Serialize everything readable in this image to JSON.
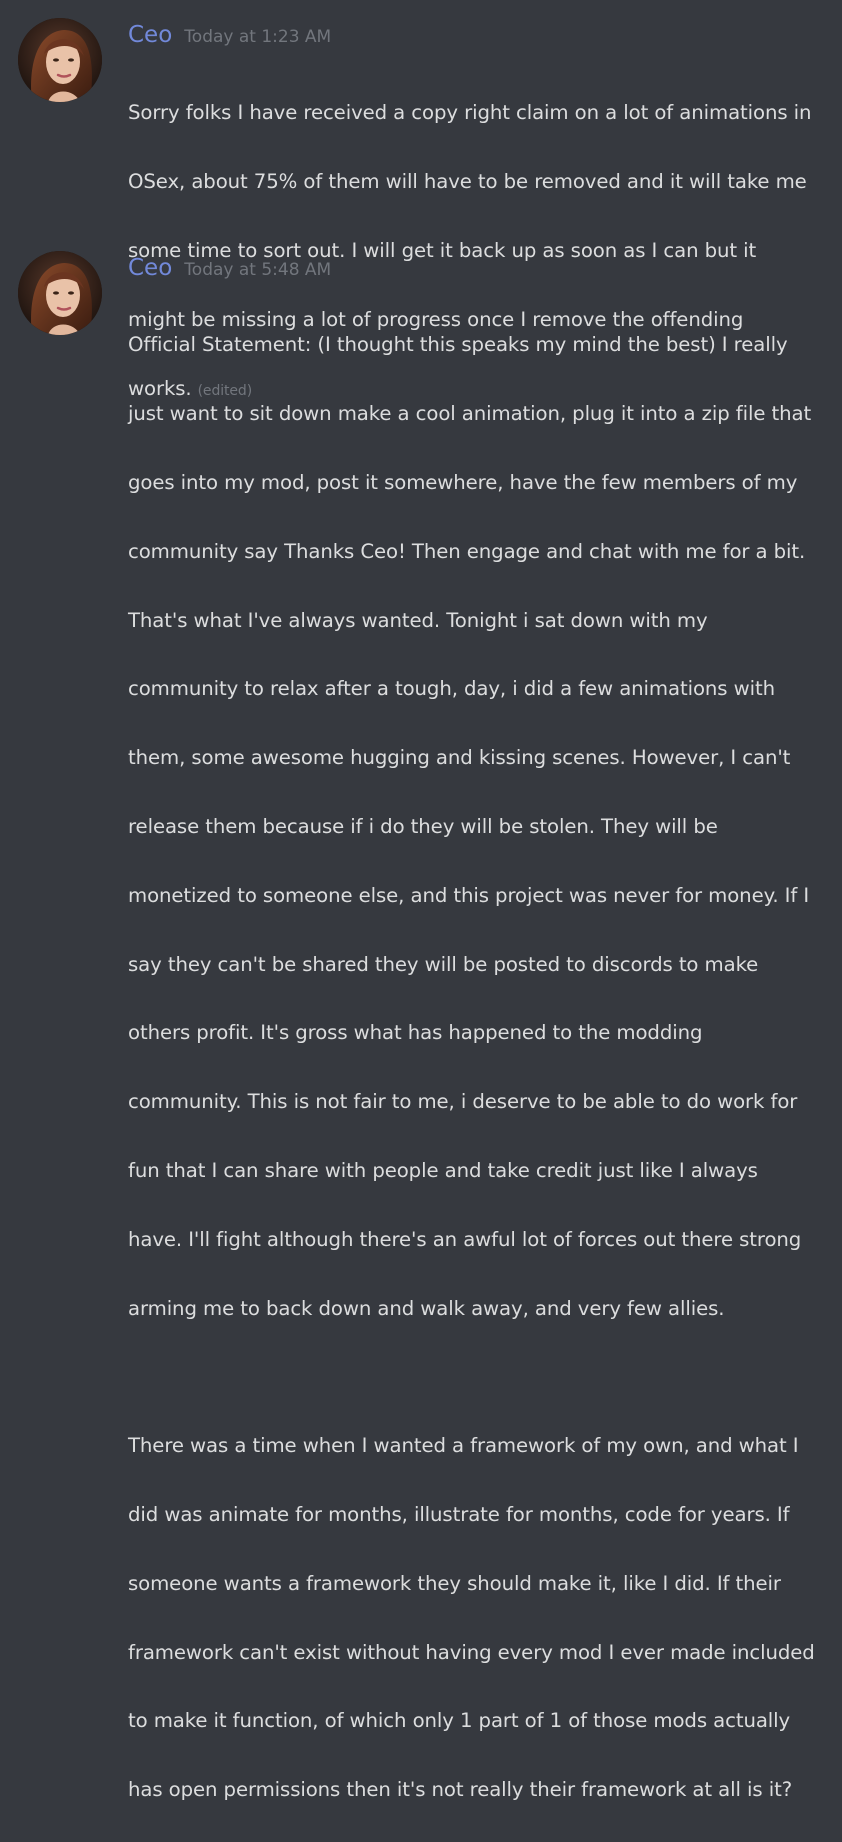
{
  "colors": {
    "background": "#36393f",
    "username": "#7289da",
    "timestamp": "#72767d",
    "text": "#dcddde"
  },
  "messages": [
    {
      "author": "Ceo",
      "timestamp": "Today at 1:23 AM",
      "avatar_icon": "user-avatar",
      "lines": [
        "Sorry folks I have received a copy right claim on a lot of animations in",
        "OSex, about 75% of them will have to be removed and it will take me",
        "some time to sort out. I will get it back up as soon as I can but it",
        "might be missing a lot of progress once I remove the offending",
        "works."
      ],
      "edited_label": "(edited)"
    },
    {
      "author": "Ceo",
      "timestamp": "Today at 5:48 AM",
      "avatar_icon": "user-avatar",
      "paragraphs": [
        [
          "Official Statement: (I thought this speaks my mind the best) I really",
          "just want to sit down make a cool animation, plug it into a zip file that",
          "goes into my mod, post it somewhere, have the few members of my",
          "community say Thanks Ceo! Then engage and chat with me for a bit.",
          "That's what I've always wanted.  Tonight i sat down with my",
          "community to relax after a tough, day, i did a few animations with",
          "them, some awesome hugging and kissing scenes. However, I can't",
          "release them because if i do they will be stolen. They will be",
          "monetized to someone else, and this project was never for money. If I",
          "say they can't be shared they will be posted to discords to make",
          "others profit. It's gross what has happened to the modding",
          "community. This is not fair to me, i deserve to be able to do work for",
          "fun that I can share with people and take credit just like I always",
          "have. I'll fight although there's an awful lot of forces out there strong",
          "arming me to back down and walk away, and very few allies."
        ],
        [
          "There was a time when I wanted a framework of my own, and what I",
          "did was animate for months, illustrate for months, code for years. If",
          "someone wants a framework they should make it, like I did. If their",
          "framework can't exist without having every mod I ever made included",
          "to make it function, of which only 1 part of 1 of those mods actually",
          "has open permissions then it's not really their framework at all is it?"
        ]
      ]
    }
  ]
}
